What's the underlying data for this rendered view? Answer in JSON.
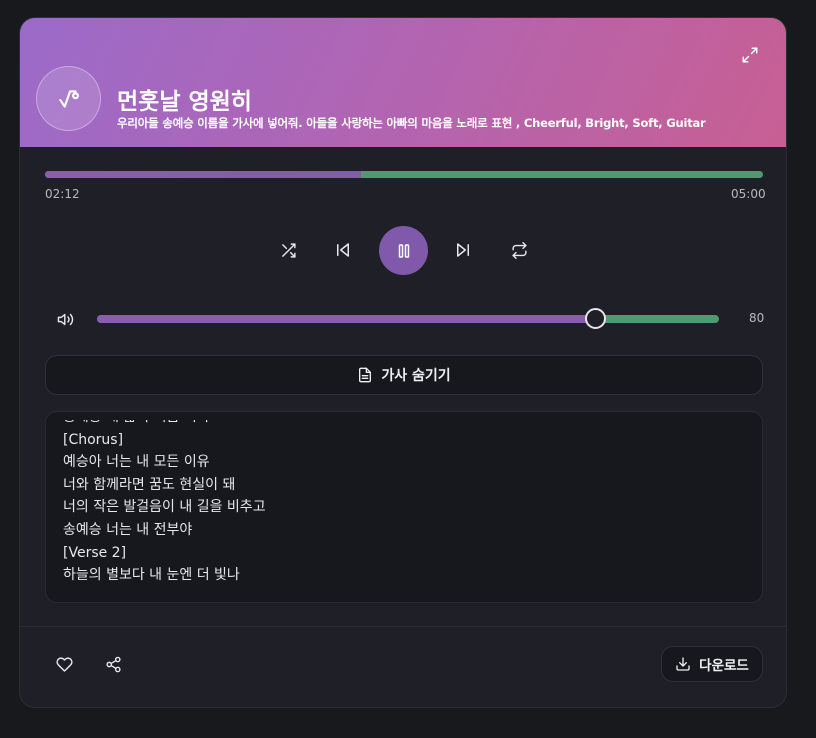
{
  "player": {
    "title": "먼훗날 영원히",
    "description": "우리아들 송예승 이름을 가사에 넣어줘. 아들을 사랑하는 아빠의 마음을 노래로 표현 , Cheerful, Bright, Soft, Guitar",
    "current_time": "02:12",
    "total_time": "05:00",
    "progress": 0.44,
    "volume": 80,
    "volume_label": "80",
    "is_playing": true
  },
  "icons": {
    "album": "music-note-icon",
    "expand": "expand-icon",
    "shuffle": "shuffle-icon",
    "previous": "skip-previous-icon",
    "pause": "pause-icon",
    "next": "skip-next-icon",
    "repeat": "repeat-icon",
    "volume": "volume-icon",
    "lyrics": "document-icon",
    "like": "heart-icon",
    "share": "share-icon",
    "download": "download-icon"
  },
  "lyrics_toggle_label": "가사 숨기기",
  "lyrics": [
    "송예승 내 삶의 기쁨 너야",
    "[Chorus]",
    "예승아 너는 내 모든 이유",
    "너와 함께라면 꿈도 현실이 돼",
    "너의 작은 발걸음이 내 길을 비추고",
    "송예승 너는 내 전부야",
    "[Verse 2]",
    "하늘의 별보다 내 눈엔 더 빛나"
  ],
  "footer": {
    "download_label": "다운로드"
  },
  "colors": {
    "accent": "#8059aa",
    "progress_remaining": "#4e9a73",
    "header_gradient_start": "#9b6bc9",
    "header_gradient_end": "#c85f93",
    "background": "#18191d",
    "card": "#1f2027"
  }
}
